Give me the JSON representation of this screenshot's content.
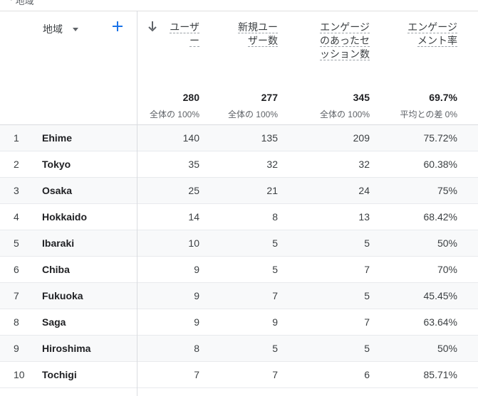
{
  "topbar": {
    "cut_text": "ᄾ 地域"
  },
  "dimension": {
    "label": "地域"
  },
  "columns": [
    {
      "label": "ユーザ\nー",
      "total": "280",
      "sub": "全体の 100%"
    },
    {
      "label": "新規ユー\nザー数",
      "total": "277",
      "sub": "全体の 100%"
    },
    {
      "label": "エンゲージ\nのあったセ\nッション数",
      "total": "345",
      "sub": "全体の 100%"
    },
    {
      "label": "エンゲージ\nメント率",
      "total": "69.7%",
      "sub": "平均との差 0%"
    }
  ],
  "rows": [
    {
      "idx": "1",
      "region": "Ehime",
      "v1": "140",
      "v2": "135",
      "v3": "209",
      "v4": "75.72%"
    },
    {
      "idx": "2",
      "region": "Tokyo",
      "v1": "35",
      "v2": "32",
      "v3": "32",
      "v4": "60.38%"
    },
    {
      "idx": "3",
      "region": "Osaka",
      "v1": "25",
      "v2": "21",
      "v3": "24",
      "v4": "75%"
    },
    {
      "idx": "4",
      "region": "Hokkaido",
      "v1": "14",
      "v2": "8",
      "v3": "13",
      "v4": "68.42%"
    },
    {
      "idx": "5",
      "region": "Ibaraki",
      "v1": "10",
      "v2": "5",
      "v3": "5",
      "v4": "50%"
    },
    {
      "idx": "6",
      "region": "Chiba",
      "v1": "9",
      "v2": "5",
      "v3": "7",
      "v4": "70%"
    },
    {
      "idx": "7",
      "region": "Fukuoka",
      "v1": "9",
      "v2": "7",
      "v3": "5",
      "v4": "45.45%"
    },
    {
      "idx": "8",
      "region": "Saga",
      "v1": "9",
      "v2": "9",
      "v3": "7",
      "v4": "63.64%"
    },
    {
      "idx": "9",
      "region": "Hiroshima",
      "v1": "8",
      "v2": "5",
      "v3": "5",
      "v4": "50%"
    },
    {
      "idx": "10",
      "region": "Tochigi",
      "v1": "7",
      "v2": "7",
      "v3": "6",
      "v4": "85.71%"
    }
  ],
  "icons": {
    "add": "add-icon",
    "sort": "sort-descending-icon",
    "dropdown": "dropdown-icon"
  },
  "colors": {
    "accent": "#1a73e8",
    "alt_row": "#f8f9fa",
    "divider": "#dadce0"
  }
}
